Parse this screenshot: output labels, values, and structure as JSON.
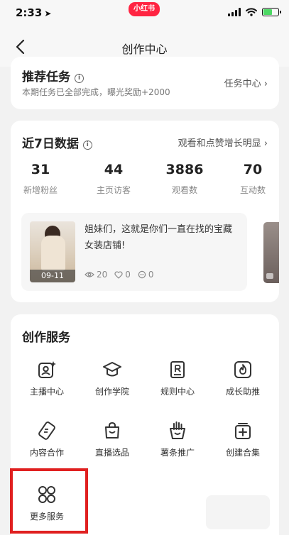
{
  "status_bar": {
    "time": "2:33",
    "app_badge": "小红书"
  },
  "nav": {
    "title": "创作中心"
  },
  "tasks": {
    "title": "推荐任务",
    "subtitle": "本期任务已全部完成，曝光奖励+2000",
    "link": "任务中心"
  },
  "stats": {
    "title": "近7日数据",
    "link": "观看和点赞增长明显",
    "items": [
      {
        "value": "31",
        "label": "新增粉丝"
      },
      {
        "value": "44",
        "label": "主页访客"
      },
      {
        "value": "3886",
        "label": "观看数"
      },
      {
        "value": "70",
        "label": "互动数"
      }
    ],
    "note": {
      "date": "09-11",
      "text": "姐妹们，这就是你们一直在找的宝藏女装店铺!",
      "views": "20",
      "likes": "0",
      "comments": "0"
    }
  },
  "services": {
    "title": "创作服务",
    "items": [
      {
        "label": "主播中心",
        "icon": "host-center-icon"
      },
      {
        "label": "创作学院",
        "icon": "academy-cap-icon"
      },
      {
        "label": "规则中心",
        "icon": "rules-book-icon"
      },
      {
        "label": "成长助推",
        "icon": "flame-boost-icon"
      },
      {
        "label": "内容合作",
        "icon": "content-coop-icon"
      },
      {
        "label": "直播选品",
        "icon": "shopping-bag-icon"
      },
      {
        "label": "薯条推广",
        "icon": "fries-promo-icon"
      },
      {
        "label": "创建合集",
        "icon": "add-collection-icon"
      },
      {
        "label": "更多服务",
        "icon": "grid-circles-icon"
      }
    ]
  }
}
